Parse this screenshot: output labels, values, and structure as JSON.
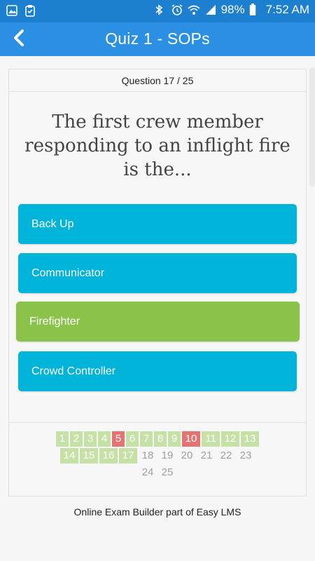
{
  "status": {
    "battery": "98%",
    "time": "7:52 AM"
  },
  "app": {
    "title": "Quiz 1 - SOPs"
  },
  "quiz": {
    "counter": "Question 17 / 25",
    "question": "The first crew member responding to an inflight fire is the...",
    "answers": [
      "Back Up",
      "Communicator",
      "Firefighter",
      "Crowd Controller"
    ],
    "selected_answer": 2
  },
  "nav": {
    "numbers": [
      "1",
      "2",
      "3",
      "4",
      "5",
      "6",
      "7",
      "8",
      "9",
      "10",
      "11",
      "12",
      "13",
      "14",
      "15",
      "16",
      "17",
      "18",
      "19",
      "20",
      "21",
      "22",
      "23",
      "24",
      "25"
    ],
    "states": [
      "ok",
      "ok",
      "ok",
      "ok",
      "bad",
      "ok",
      "ok",
      "ok",
      "ok",
      "bad",
      "ok",
      "ok",
      "ok",
      "ok",
      "ok",
      "ok",
      "ok",
      "none",
      "none",
      "none",
      "none",
      "none",
      "none",
      "none",
      "none"
    ]
  },
  "footer": {
    "text": "Online Exam Builder part of Easy LMS"
  },
  "colors": {
    "statusbar": "#1c7fd0",
    "appbar": "#2b8fe3",
    "answer": "#00b4d9",
    "correct": "#8bc34a",
    "ok_number": "#c5e1a5",
    "bad_number": "#e57373"
  }
}
